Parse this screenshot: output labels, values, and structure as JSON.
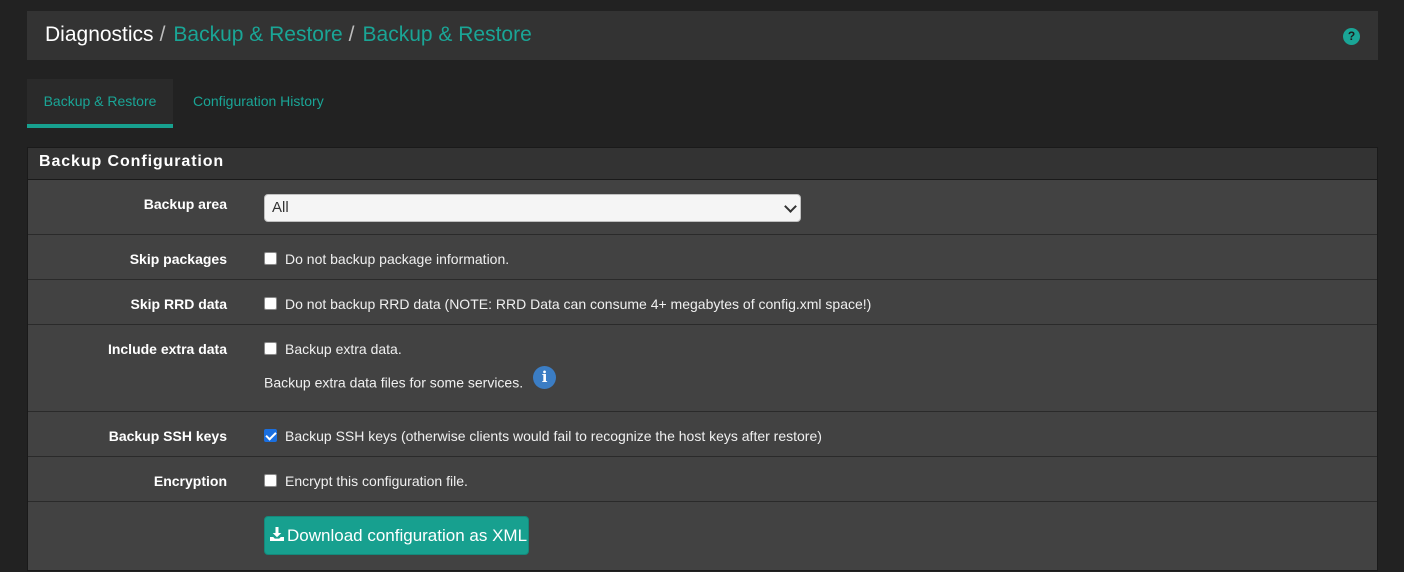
{
  "breadcrumb": {
    "root": "Diagnostics",
    "separator": "/",
    "links": [
      "Backup & Restore",
      "Backup & Restore"
    ]
  },
  "header": {
    "help_icon": "?"
  },
  "tabs": [
    {
      "label": "Backup & Restore",
      "active": true
    },
    {
      "label": "Configuration History",
      "active": false
    }
  ],
  "panel": {
    "title": "Backup Configuration",
    "backup_area": {
      "label": "Backup area",
      "selected": "All"
    },
    "skip_packages": {
      "label": "Skip packages",
      "checkbox_label": "Do not backup package information.",
      "checked": false
    },
    "skip_rrd": {
      "label": "Skip RRD data",
      "checkbox_label": "Do not backup RRD data (NOTE: RRD Data can consume 4+ megabytes of config.xml space!)",
      "checked": false
    },
    "extra_data": {
      "label": "Include extra data",
      "checkbox_label": "Backup extra data.",
      "help": "Backup extra data files for some services.",
      "info_icon": "i",
      "checked": false
    },
    "ssh_keys": {
      "label": "Backup SSH keys",
      "checkbox_label": "Backup SSH keys (otherwise clients would fail to recognize the host keys after restore)",
      "checked": true
    },
    "encryption": {
      "label": "Encryption",
      "checkbox_label": "Encrypt this configuration file.",
      "checked": false
    },
    "download_button": "Download configuration as XML"
  },
  "colors": {
    "accent": "#1aa596",
    "background": "#222222",
    "panel": "#424242",
    "checkbox_checked": "#1a6fe0"
  }
}
